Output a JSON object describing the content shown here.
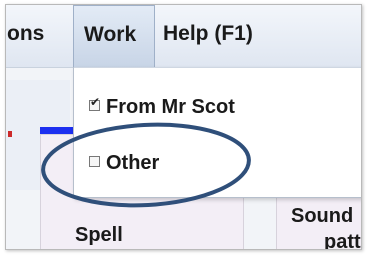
{
  "menubar": {
    "items": [
      {
        "label": "ons"
      },
      {
        "label": "Work"
      },
      {
        "label": "Help (F1)"
      }
    ]
  },
  "work_menu": {
    "items": [
      {
        "label": "From Mr Scot",
        "checked": true
      },
      {
        "label": "Other",
        "checked": false
      }
    ]
  },
  "background": {
    "cards": [
      {
        "label": "Spell"
      },
      {
        "label_line1": "Sound",
        "label_line2": "patt"
      }
    ]
  },
  "colors": {
    "annotation_ellipse": "#2f4f7a",
    "blue_bar": "#1c2ff0",
    "yellow_bar": "#f1e10c"
  },
  "icons": {
    "checked": "checkbox-checked-icon",
    "unchecked": "checkbox-empty-icon"
  }
}
